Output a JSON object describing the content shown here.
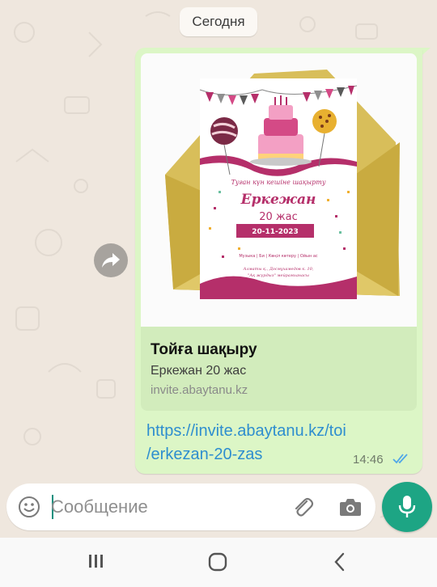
{
  "chat": {
    "date_chip": "Сегодня",
    "message": {
      "link_preview": {
        "title": "Тойға шақыру",
        "description": "Еркежан 20 жас",
        "domain": "invite.abaytanu.kz",
        "image": {
          "heading": "Туған күн кешіне шақырту",
          "name": "Еркежан",
          "age": "20 жас",
          "date": "20-11-2023",
          "details": "Музыка | Би | Көңіл көтеру | Ойын ас",
          "address_line1": "Алматы қ., Досмұхамедов к. 10,",
          "address_line2": "\"Ақ жүрдыз\" мейрамханасы"
        }
      },
      "link_line1": "https://invite.abaytanu.kz/toi",
      "link_line2": "/erkezan-20-zas",
      "time": "14:46",
      "status": "read"
    }
  },
  "composer": {
    "placeholder": "Сообщение",
    "value": ""
  },
  "icons": {
    "forward": "forward-icon",
    "emoji": "emoji-icon",
    "attach": "paperclip-icon",
    "camera": "camera-icon",
    "mic": "mic-icon",
    "read_receipt": "double-check-icon"
  },
  "colors": {
    "chat_background": "#efe7de",
    "bubble": "#dcf6c6",
    "link": "#2e8ecf",
    "accent": "#1da584",
    "read_ticks": "#4fa6e8",
    "invite_primary": "#b52f6a"
  },
  "navbar": {
    "buttons": [
      "recents-button",
      "home-button",
      "back-button"
    ]
  }
}
